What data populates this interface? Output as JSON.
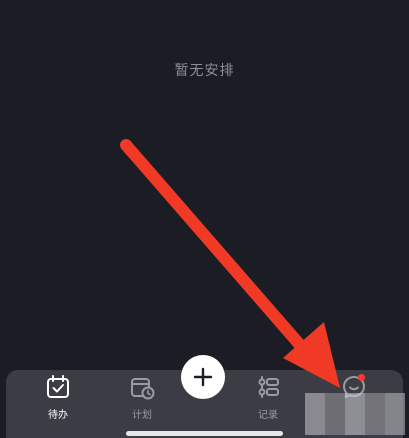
{
  "main": {
    "empty_state_text": "暂无安排"
  },
  "tabbar": {
    "items": [
      {
        "label": "待办",
        "icon": "calendar-check-icon",
        "active": true
      },
      {
        "label": "计划",
        "icon": "calendar-clock-icon",
        "active": false
      },
      {
        "label": "",
        "icon": "plus-icon",
        "active": false
      },
      {
        "label": "记录",
        "icon": "list-timeline-icon",
        "active": false
      },
      {
        "label": "",
        "icon": "chat-bubble-icon",
        "active": false
      }
    ]
  },
  "colors": {
    "background": "#1c1c24",
    "tabbar": "#3c3c44",
    "annotation_arrow": "#f03a26",
    "badge": "#ff3b30"
  }
}
